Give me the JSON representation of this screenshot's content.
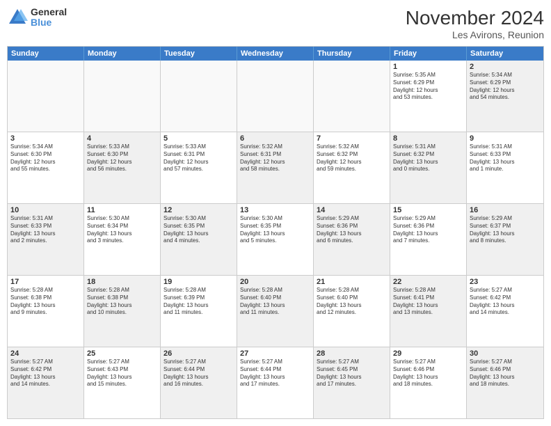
{
  "logo": {
    "general": "General",
    "blue": "Blue"
  },
  "title": "November 2024",
  "subtitle": "Les Avirons, Reunion",
  "header_days": [
    "Sunday",
    "Monday",
    "Tuesday",
    "Wednesday",
    "Thursday",
    "Friday",
    "Saturday"
  ],
  "rows": [
    [
      {
        "day": "",
        "info": "",
        "empty": true
      },
      {
        "day": "",
        "info": "",
        "empty": true
      },
      {
        "day": "",
        "info": "",
        "empty": true
      },
      {
        "day": "",
        "info": "",
        "empty": true
      },
      {
        "day": "",
        "info": "",
        "empty": true
      },
      {
        "day": "1",
        "info": "Sunrise: 5:35 AM\nSunset: 6:29 PM\nDaylight: 12 hours\nand 53 minutes.",
        "empty": false
      },
      {
        "day": "2",
        "info": "Sunrise: 5:34 AM\nSunset: 6:29 PM\nDaylight: 12 hours\nand 54 minutes.",
        "empty": false,
        "shaded": true
      }
    ],
    [
      {
        "day": "3",
        "info": "Sunrise: 5:34 AM\nSunset: 6:30 PM\nDaylight: 12 hours\nand 55 minutes.",
        "empty": false
      },
      {
        "day": "4",
        "info": "Sunrise: 5:33 AM\nSunset: 6:30 PM\nDaylight: 12 hours\nand 56 minutes.",
        "empty": false,
        "shaded": true
      },
      {
        "day": "5",
        "info": "Sunrise: 5:33 AM\nSunset: 6:31 PM\nDaylight: 12 hours\nand 57 minutes.",
        "empty": false
      },
      {
        "day": "6",
        "info": "Sunrise: 5:32 AM\nSunset: 6:31 PM\nDaylight: 12 hours\nand 58 minutes.",
        "empty": false,
        "shaded": true
      },
      {
        "day": "7",
        "info": "Sunrise: 5:32 AM\nSunset: 6:32 PM\nDaylight: 12 hours\nand 59 minutes.",
        "empty": false
      },
      {
        "day": "8",
        "info": "Sunrise: 5:31 AM\nSunset: 6:32 PM\nDaylight: 13 hours\nand 0 minutes.",
        "empty": false,
        "shaded": true
      },
      {
        "day": "9",
        "info": "Sunrise: 5:31 AM\nSunset: 6:33 PM\nDaylight: 13 hours\nand 1 minute.",
        "empty": false
      }
    ],
    [
      {
        "day": "10",
        "info": "Sunrise: 5:31 AM\nSunset: 6:33 PM\nDaylight: 13 hours\nand 2 minutes.",
        "empty": false,
        "shaded": true
      },
      {
        "day": "11",
        "info": "Sunrise: 5:30 AM\nSunset: 6:34 PM\nDaylight: 13 hours\nand 3 minutes.",
        "empty": false
      },
      {
        "day": "12",
        "info": "Sunrise: 5:30 AM\nSunset: 6:35 PM\nDaylight: 13 hours\nand 4 minutes.",
        "empty": false,
        "shaded": true
      },
      {
        "day": "13",
        "info": "Sunrise: 5:30 AM\nSunset: 6:35 PM\nDaylight: 13 hours\nand 5 minutes.",
        "empty": false
      },
      {
        "day": "14",
        "info": "Sunrise: 5:29 AM\nSunset: 6:36 PM\nDaylight: 13 hours\nand 6 minutes.",
        "empty": false,
        "shaded": true
      },
      {
        "day": "15",
        "info": "Sunrise: 5:29 AM\nSunset: 6:36 PM\nDaylight: 13 hours\nand 7 minutes.",
        "empty": false
      },
      {
        "day": "16",
        "info": "Sunrise: 5:29 AM\nSunset: 6:37 PM\nDaylight: 13 hours\nand 8 minutes.",
        "empty": false,
        "shaded": true
      }
    ],
    [
      {
        "day": "17",
        "info": "Sunrise: 5:28 AM\nSunset: 6:38 PM\nDaylight: 13 hours\nand 9 minutes.",
        "empty": false
      },
      {
        "day": "18",
        "info": "Sunrise: 5:28 AM\nSunset: 6:38 PM\nDaylight: 13 hours\nand 10 minutes.",
        "empty": false,
        "shaded": true
      },
      {
        "day": "19",
        "info": "Sunrise: 5:28 AM\nSunset: 6:39 PM\nDaylight: 13 hours\nand 11 minutes.",
        "empty": false
      },
      {
        "day": "20",
        "info": "Sunrise: 5:28 AM\nSunset: 6:40 PM\nDaylight: 13 hours\nand 11 minutes.",
        "empty": false,
        "shaded": true
      },
      {
        "day": "21",
        "info": "Sunrise: 5:28 AM\nSunset: 6:40 PM\nDaylight: 13 hours\nand 12 minutes.",
        "empty": false
      },
      {
        "day": "22",
        "info": "Sunrise: 5:28 AM\nSunset: 6:41 PM\nDaylight: 13 hours\nand 13 minutes.",
        "empty": false,
        "shaded": true
      },
      {
        "day": "23",
        "info": "Sunrise: 5:27 AM\nSunset: 6:42 PM\nDaylight: 13 hours\nand 14 minutes.",
        "empty": false
      }
    ],
    [
      {
        "day": "24",
        "info": "Sunrise: 5:27 AM\nSunset: 6:42 PM\nDaylight: 13 hours\nand 14 minutes.",
        "empty": false,
        "shaded": true
      },
      {
        "day": "25",
        "info": "Sunrise: 5:27 AM\nSunset: 6:43 PM\nDaylight: 13 hours\nand 15 minutes.",
        "empty": false
      },
      {
        "day": "26",
        "info": "Sunrise: 5:27 AM\nSunset: 6:44 PM\nDaylight: 13 hours\nand 16 minutes.",
        "empty": false,
        "shaded": true
      },
      {
        "day": "27",
        "info": "Sunrise: 5:27 AM\nSunset: 6:44 PM\nDaylight: 13 hours\nand 17 minutes.",
        "empty": false
      },
      {
        "day": "28",
        "info": "Sunrise: 5:27 AM\nSunset: 6:45 PM\nDaylight: 13 hours\nand 17 minutes.",
        "empty": false,
        "shaded": true
      },
      {
        "day": "29",
        "info": "Sunrise: 5:27 AM\nSunset: 6:46 PM\nDaylight: 13 hours\nand 18 minutes.",
        "empty": false
      },
      {
        "day": "30",
        "info": "Sunrise: 5:27 AM\nSunset: 6:46 PM\nDaylight: 13 hours\nand 18 minutes.",
        "empty": false,
        "shaded": true
      }
    ]
  ]
}
